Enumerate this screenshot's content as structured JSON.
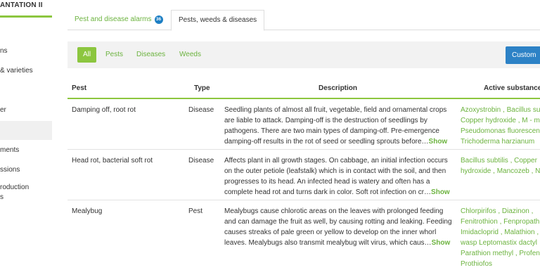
{
  "sidebar": {
    "title": "ANTATION II",
    "items": [
      {
        "label": "ns"
      },
      {
        "label": "& varieties"
      },
      {
        "label": "er"
      },
      {
        "label": ""
      },
      {
        "label": "ments"
      },
      {
        "label": "ssions"
      },
      {
        "label": "roduction",
        "label2": "s"
      }
    ]
  },
  "tabs": {
    "alarms_label": "Pest and disease alarms",
    "alarms_count": "36",
    "pwd_label": "Pests, weeds & diseases"
  },
  "filters": {
    "all": "All",
    "pests": "Pests",
    "diseases": "Diseases",
    "weeds": "Weeds",
    "custom": "Custom"
  },
  "table": {
    "headers": {
      "pest": "Pest",
      "type": "Type",
      "description": "Description",
      "substances": "Active substance"
    },
    "rows": [
      {
        "pest": "Damping off, root rot",
        "type": "Disease",
        "description": "Seedling plants of almost all fruit, vegetable, field and ornamental crops are liable to attack. Damping-off is the destruction of seedlings by pathogens. There are two main types of damping-off. Pre-emergence damping-off results in the rot of seed or seedling sprouts before…",
        "show": "Show",
        "substances": [
          "Azoxystrobin , Bacillus su",
          "Copper hydroxide , M - m",
          "Pseudomonas fluorescen",
          "Trichoderma harzianum"
        ]
      },
      {
        "pest": "Head rot, bacterial soft rot",
        "type": "Disease",
        "description": "Affects plant in all growth stages. On cabbage, an initial infection occurs on the outer petiole (leafstalk) which is in contact with the soil, and then progresses to its head. An infected head is watery and often has a complete head rot and turns dark in color. Soft rot infection on cr…",
        "show": "Show",
        "substances": [
          "Bacillus subtilis , Copper",
          "hydroxide , Mancozeb , N"
        ]
      },
      {
        "pest": "Mealybug",
        "type": "Pest",
        "description": "Mealybugs cause chlorotic areas on the leaves with prolonged feeding and can damage the fruit as well, by causing rotting and leaking. Feeding causes streaks of pale green or yellow to develop on the inner whorl leaves. Mealybugs also transmit mealybug wilt virus, which caus…",
        "show": "Show",
        "substances": [
          "Chlorpirifos , Diazinon ,",
          "Fenitrothion , Fenpropath",
          "Imidacloprid , Malathion ,",
          "wasp Leptomastix dactyl",
          "Parathion methyl , Profen",
          "Prothiofos"
        ]
      }
    ]
  },
  "colors": {
    "accent_green": "#8cc63f",
    "link_green": "#6cb33f",
    "badge_blue": "#1d7fc4",
    "button_blue": "#2d82c6"
  }
}
